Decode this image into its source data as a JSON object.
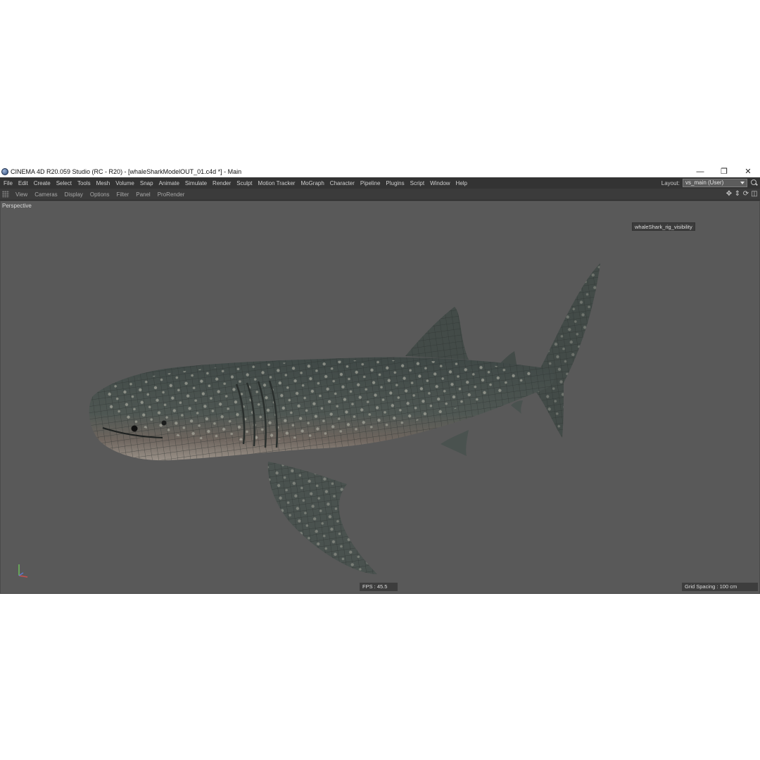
{
  "window": {
    "title": "CINEMA 4D R20.059 Studio (RC - R20) - [whaleSharkModelOUT_01.c4d *] - Main",
    "controls": [
      "minimize",
      "restore",
      "close"
    ]
  },
  "menu": {
    "items": [
      "File",
      "Edit",
      "Create",
      "Select",
      "Tools",
      "Mesh",
      "Volume",
      "Snap",
      "Animate",
      "Simulate",
      "Render",
      "Sculpt",
      "Motion Tracker",
      "MoGraph",
      "Character",
      "Pipeline",
      "Plugins",
      "Script",
      "Window",
      "Help"
    ],
    "layout_label": "Layout:",
    "layout_value": "vs_main (User)"
  },
  "viewport_menu": {
    "items": [
      "View",
      "Cameras",
      "Display",
      "Options",
      "Filter",
      "Panel",
      "ProRender"
    ],
    "nav_icons": [
      "move-icon",
      "zoom-icon",
      "rotate-icon",
      "maximize-icon"
    ]
  },
  "viewport": {
    "camera_label": "Perspective",
    "object_tag": "whaleShark_rig_visibility",
    "fps": "FPS : 45.5",
    "grid_spacing": "Grid Spacing : 100 cm",
    "colors": {
      "background": "#595959",
      "skin": "#4c5552",
      "belly": "#9a9188",
      "wire": "#2b2f2e"
    }
  }
}
